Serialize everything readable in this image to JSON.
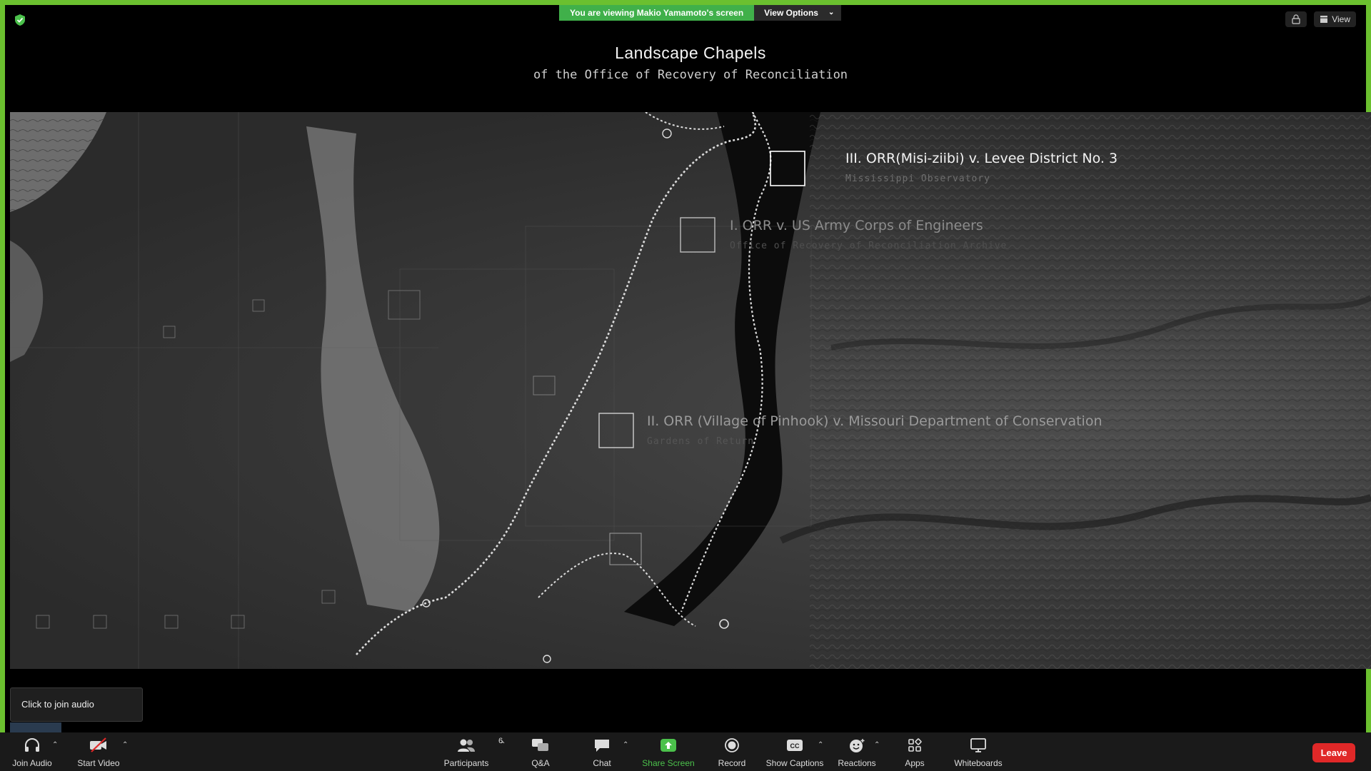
{
  "banner": {
    "viewing_text": "You are viewing Makio Yamamoto's screen",
    "view_options_label": "View Options",
    "view_label": "View"
  },
  "slide": {
    "title": "Landscape Chapels",
    "subtitle": "of the Office of Recovery of Reconciliation",
    "sites": [
      {
        "title": "III. ORR(Misi-ziibi) v. Levee District No. 3",
        "subtitle": "Mississippi Observatory"
      },
      {
        "title": "I. ORR v. US Army Corps of Engineers",
        "subtitle": "Office of Recovery of Reconciliation Archive"
      },
      {
        "title": "II. ORR (Village of Pinhook) v. Missouri Department of Conservation",
        "subtitle": "Gardens of Return"
      }
    ]
  },
  "audio_popup": {
    "text": "Click to join audio"
  },
  "toolbar": {
    "join_audio": "Join Audio",
    "start_video": "Start Video",
    "participants": "Participants",
    "participants_count": "6",
    "qa": "Q&A",
    "chat": "Chat",
    "share_screen": "Share Screen",
    "record": "Record",
    "show_captions": "Show Captions",
    "reactions": "Reactions",
    "apps": "Apps",
    "whiteboards": "Whiteboards",
    "leave": "Leave"
  },
  "colors": {
    "share_border": "#6bc02f",
    "banner_green": "#40b04a",
    "share_screen_green": "#4bc14b",
    "leave_red": "#e02828"
  }
}
